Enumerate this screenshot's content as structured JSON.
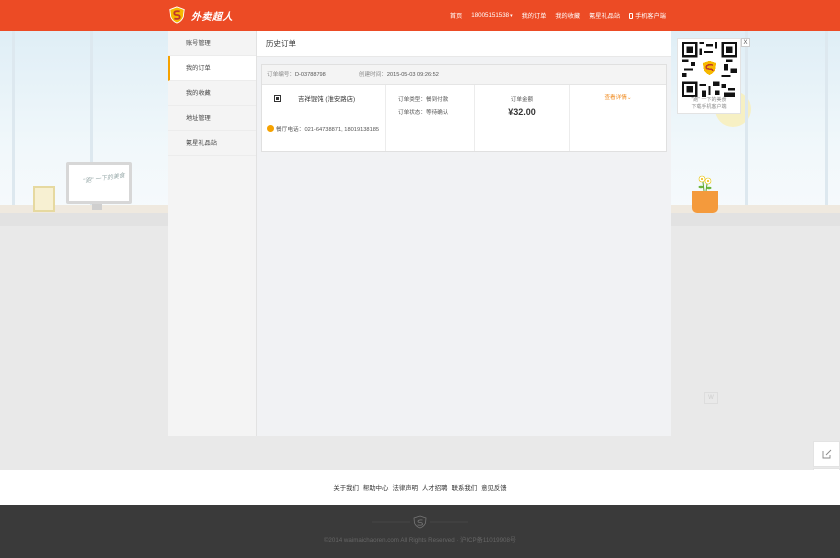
{
  "header": {
    "logo_text": "外卖超人",
    "nav": {
      "home": "首页",
      "phone_user": "18005151538",
      "my_orders": "我的订单",
      "my_favorites": "我的收藏",
      "gift_store": "氪星礼品站",
      "mobile_client": "手机客户端"
    },
    "color": "#ec4b25"
  },
  "sidebar": {
    "items": [
      {
        "label": "账号管理"
      },
      {
        "label": "我的订单"
      },
      {
        "label": "我的收藏"
      },
      {
        "label": "地址管理"
      },
      {
        "label": "氪星礼品站"
      }
    ],
    "active_index": 1
  },
  "main": {
    "title": "历史订单",
    "order": {
      "number_label": "订单编号：",
      "number": "D-03788798",
      "time_label": "创建时间：",
      "time": "2015-05-03 09:26:52",
      "restaurant": "吉祥馄饨 (淮安路店)",
      "tel_label": "餐厅电话：",
      "tel": "021-64738871, 18019138185",
      "type_label": "订单类型：",
      "type": "餐到付款",
      "status_label": "订单状态：",
      "status": "等待确认",
      "amount_label": "订单金额",
      "amount": "¥32.00",
      "detail_link": "查看详情"
    }
  },
  "qr_popup": {
    "close": "X",
    "line1": "\"跑\" 一下的美食",
    "line2": "下载手机客户端"
  },
  "decor": {
    "monitor_text": "\"跑\" 一下的美食"
  },
  "footer": {
    "links": [
      "关于我们",
      "帮助中心",
      "法律声明",
      "人才招聘",
      "联系我们",
      "意见反馈"
    ],
    "copyright": "©2014 waimaichaoren.com All Rights Reserved · 沪ICP备11019908号"
  },
  "icons": {
    "logo": "shield-s-icon",
    "tool_edit": "edit-icon",
    "tool_qr": "qr-icon",
    "restaurant": "restaurant-icon",
    "phone": "phone-icon"
  }
}
